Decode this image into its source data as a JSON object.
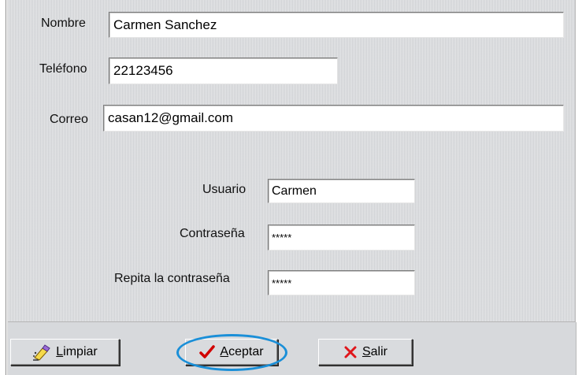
{
  "form": {
    "nombre": {
      "label": "Nombre",
      "value": "Carmen Sanchez"
    },
    "telefono": {
      "label": "Teléfono",
      "value": "22123456"
    },
    "correo": {
      "label": "Correo",
      "value": "casan12@gmail.com"
    },
    "usuario": {
      "label": "Usuario",
      "value": "Carmen"
    },
    "contrasena": {
      "label": "Contraseña",
      "value": "*****"
    },
    "repita": {
      "label": "Repita la contraseña",
      "value": "*****"
    }
  },
  "buttons": {
    "limpiar": {
      "first": "L",
      "rest": "impiar",
      "icon": "eraser-icon"
    },
    "aceptar": {
      "first": "A",
      "rest": "ceptar",
      "icon": "checkmark-icon"
    },
    "salir": {
      "first": "S",
      "rest": "alir",
      "icon": "x-icon"
    }
  },
  "colors": {
    "form_background": "#d7d9dc",
    "highlight_ellipse": "#1a8fd8",
    "check_red": "#d10000",
    "x_red": "#e0161b"
  }
}
